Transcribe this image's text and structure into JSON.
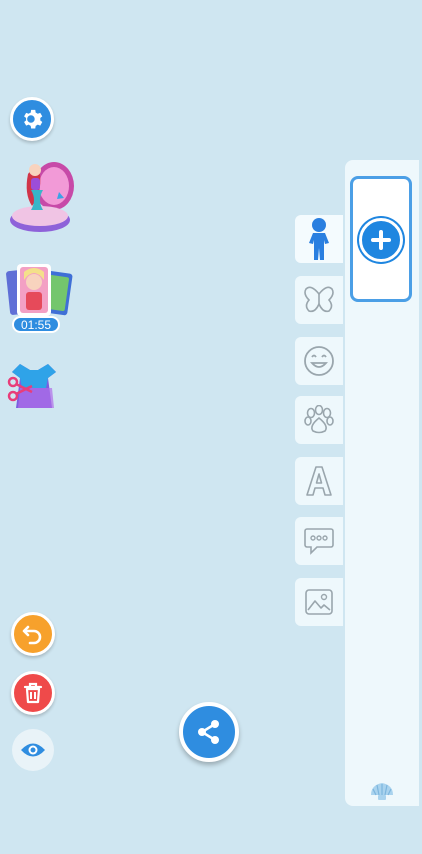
{
  "sidebar_left": {
    "settings_icon": "gear-icon",
    "mermaid_item": "mermaid-shell-character",
    "photo_cards_item": "photo-cards",
    "timer_text": "01:55",
    "outfit_item": "dress-scissors"
  },
  "bottom_controls": {
    "undo_icon": "undo-icon",
    "trash_icon": "trash-icon",
    "eye_icon": "eye-icon",
    "share_icon": "share-icon"
  },
  "category_tabs": [
    {
      "icon": "person-icon",
      "active": true
    },
    {
      "icon": "butterfly-icon",
      "active": false
    },
    {
      "icon": "emoji-icon",
      "active": false
    },
    {
      "icon": "paw-icon",
      "active": false
    },
    {
      "icon": "text-a-icon",
      "active": false
    },
    {
      "icon": "chat-bubble-icon",
      "active": false
    },
    {
      "icon": "image-icon",
      "active": false
    }
  ],
  "panel": {
    "add_icon": "plus-icon",
    "bottom_icon": "shell-icon"
  },
  "colors": {
    "background": "#cfe6f1",
    "accent_blue": "#2f8de0",
    "undo_orange": "#f7a12c",
    "trash_red": "#ef4a4a"
  }
}
